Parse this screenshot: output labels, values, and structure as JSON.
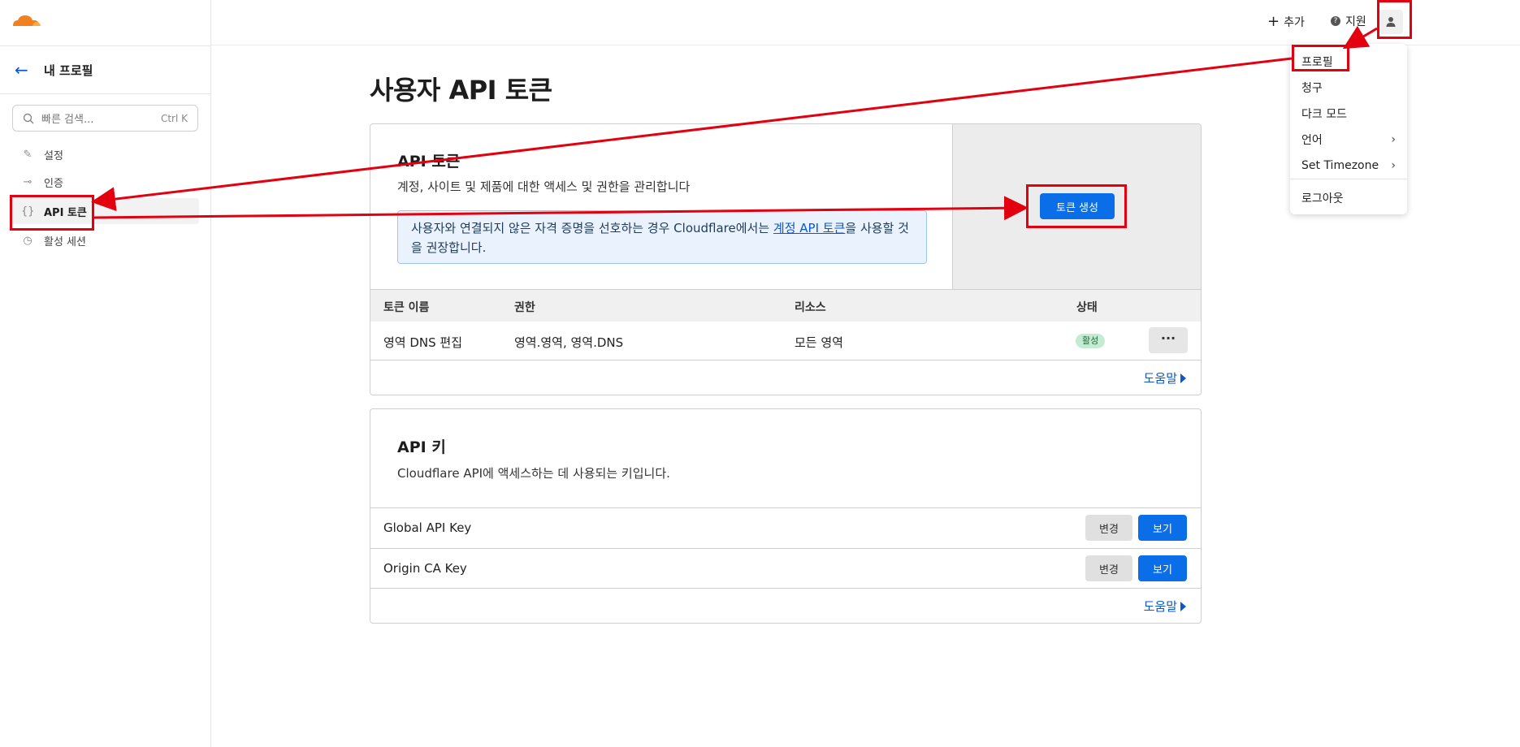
{
  "colors": {
    "accent": "#0a6ee8",
    "annotation": "#e3000f",
    "logo": "#f38020",
    "badge_bg": "#c5ecd2"
  },
  "sidebar": {
    "title": "내 프로필",
    "search_placeholder": "빠른 검색...",
    "search_shortcut": "Ctrl K",
    "items": [
      {
        "label": "설정",
        "icon": "pencil-icon"
      },
      {
        "label": "인증",
        "icon": "key-icon"
      },
      {
        "label": "API 토큰",
        "icon": "braces-icon",
        "active": true
      },
      {
        "label": "활성 세션",
        "icon": "clock-icon"
      }
    ]
  },
  "topbar": {
    "add_label": "추가",
    "support_label": "지원"
  },
  "dropdown": {
    "items": [
      {
        "label": "프로필"
      },
      {
        "label": "청구"
      },
      {
        "label": "다크 모드"
      },
      {
        "label": "언어",
        "submenu": true
      },
      {
        "label": "Set Timezone",
        "submenu": true
      },
      {
        "label": "로그아웃"
      }
    ]
  },
  "page": {
    "title": "사용자 API 토큰"
  },
  "api_tokens": {
    "title": "API 토큰",
    "description": "계정, 사이트 및 제품에 대한 액세스 및 권한을 관리합니다",
    "notice_text_1": "사용자와 연결되지 않은 자격 증명을 선호하는 경우 Cloudflare에서는 ",
    "notice_link": "계정 API 토큰",
    "notice_text_2": "을 사용할 것을 권장합니다.",
    "create_button": "토큰 생성",
    "columns": [
      "토큰 이름",
      "권한",
      "리소스",
      "상태"
    ],
    "rows": [
      {
        "name": "영역 DNS 편집",
        "permissions": "영역.영역, 영역.DNS",
        "resources": "모든 영역",
        "status": "활성"
      }
    ],
    "more_button": "···",
    "help_link": "도움말"
  },
  "api_keys": {
    "title": "API 키",
    "description": "Cloudflare API에 액세스하는 데 사용되는 키입니다.",
    "rows": [
      {
        "name": "Global API Key",
        "change_label": "변경",
        "view_label": "보기"
      },
      {
        "name": "Origin CA Key",
        "change_label": "변경",
        "view_label": "보기"
      }
    ],
    "help_link": "도움말"
  }
}
